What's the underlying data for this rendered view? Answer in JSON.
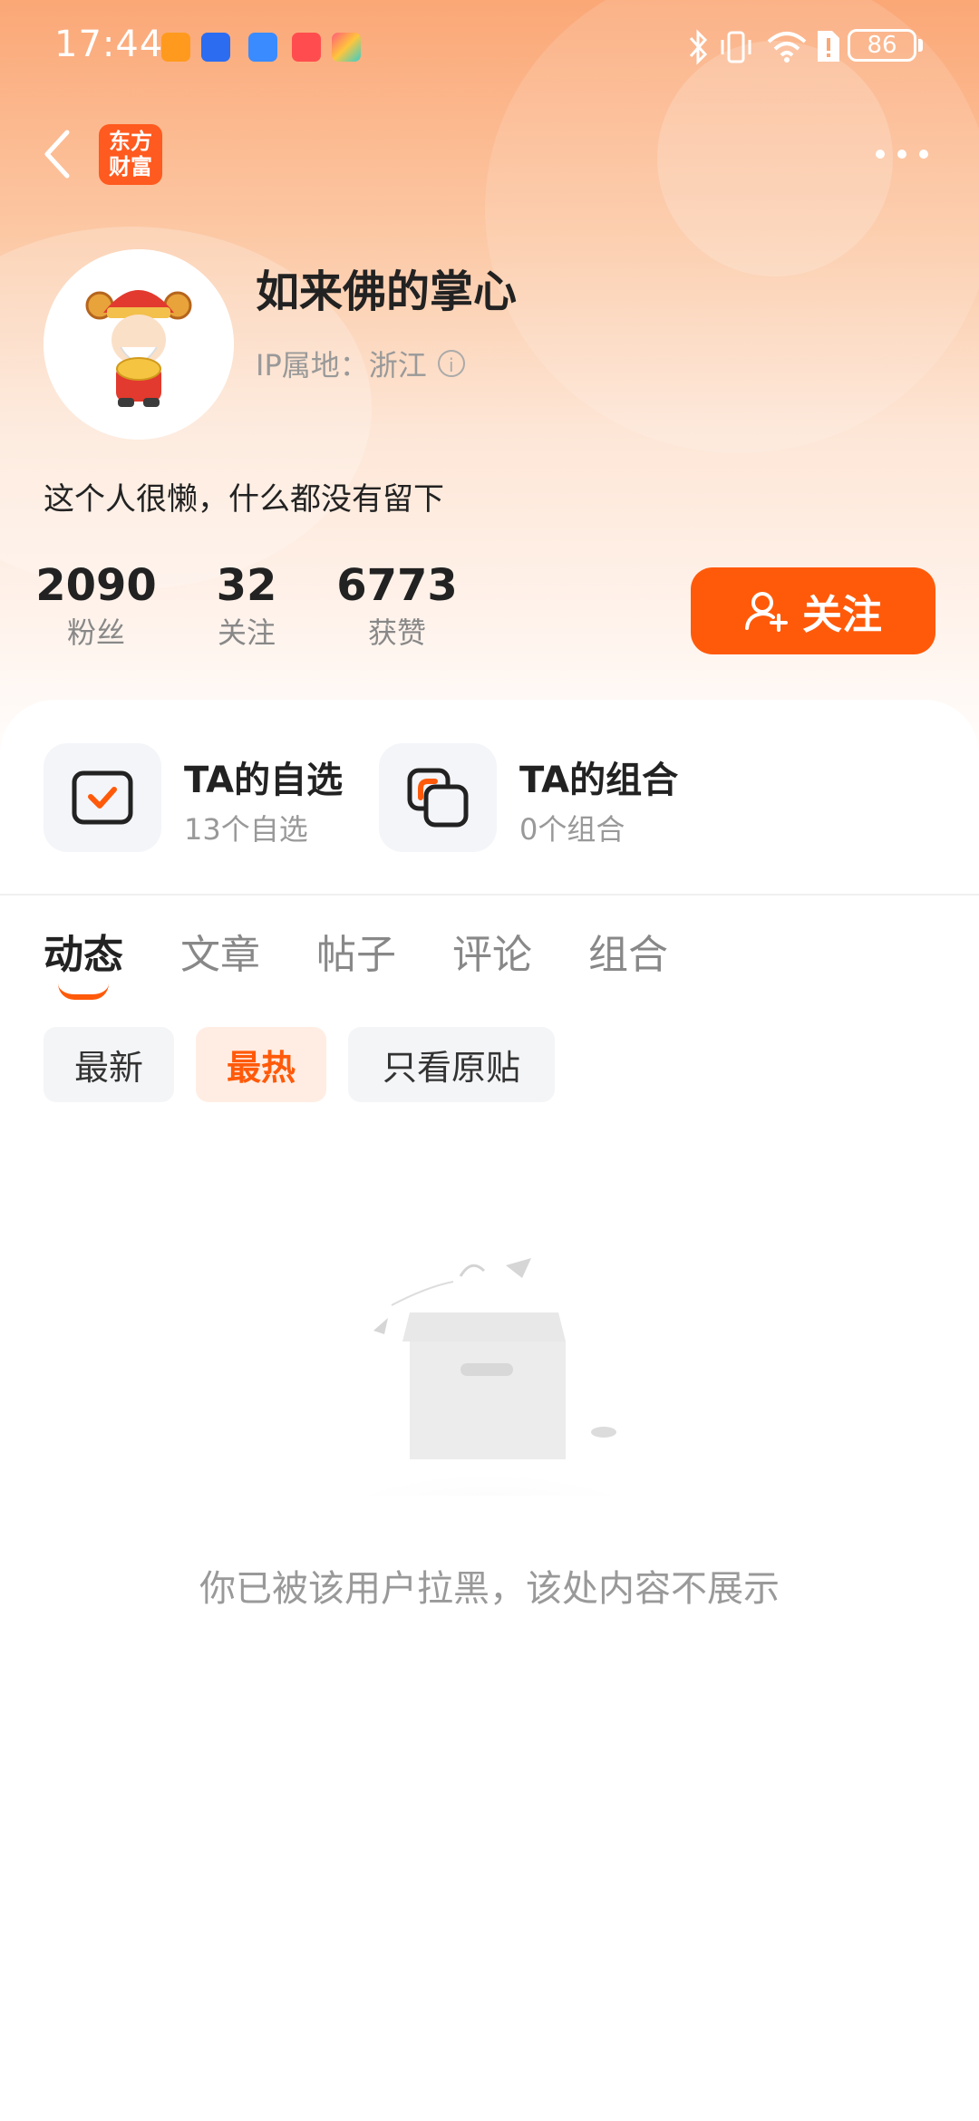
{
  "status_bar": {
    "time": "17:44",
    "battery": "86"
  },
  "header": {
    "logo_text_line1": "东方",
    "logo_text_line2": "财富"
  },
  "profile": {
    "name": "如来佛的掌心",
    "ip_location": "IP属地：浙江",
    "bio": "这个人很懒，什么都没有留下"
  },
  "stats": [
    {
      "value": "2090",
      "label": "粉丝"
    },
    {
      "value": "32",
      "label": "关注"
    },
    {
      "value": "6773",
      "label": "获赞"
    }
  ],
  "follow_button": {
    "label": "关注"
  },
  "quick_links": [
    {
      "title": "TA的自选",
      "subtitle": "13个自选"
    },
    {
      "title": "TA的组合",
      "subtitle": "0个组合"
    }
  ],
  "tabs": [
    "动态",
    "文章",
    "帖子",
    "评论",
    "组合"
  ],
  "filters": [
    "最新",
    "最热",
    "只看原贴"
  ],
  "empty_message": "你已被该用户拉黑，该处内容不展示",
  "colors": {
    "accent": "#ff5a0a"
  }
}
